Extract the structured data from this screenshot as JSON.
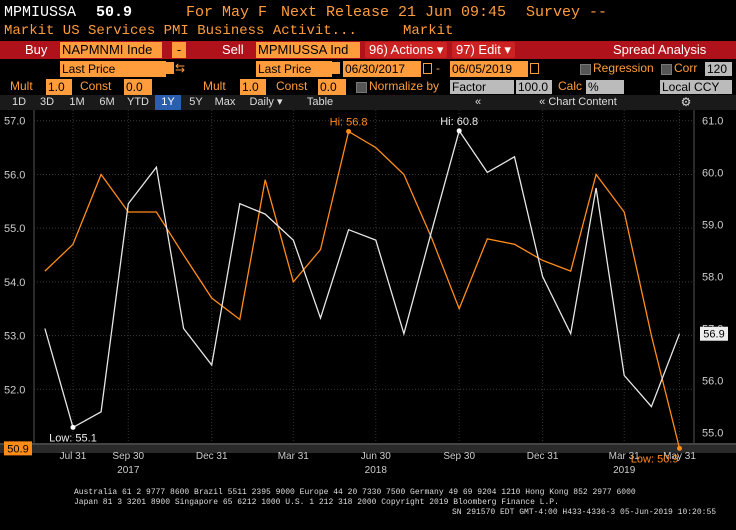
{
  "header": {
    "ticker": "MPMIUSSA",
    "value": "50.9",
    "for_label": "For May F",
    "next_release": "Next Release 21 Jun 09:45",
    "survey": "Survey --",
    "description": "Markit US Services PMI Business Activit...",
    "source": "Markit"
  },
  "toolbar": {
    "buy_label": "Buy",
    "buy_security": "NAPMNMI Inde",
    "minus": "-",
    "sell_label": "Sell",
    "sell_security": "MPMIUSSA Ind",
    "actions_label": "96) Actions ▾",
    "edit_label": "97) Edit ▾",
    "spread_label": "Spread Analysis"
  },
  "row3": {
    "field1": "Last Price",
    "swap": "⇆",
    "field2": "Last Price",
    "start_date": "06/30/2017",
    "dash": "-",
    "end_date": "06/05/2019",
    "regression": "Regression",
    "corr": "Corr",
    "corr_value": "120"
  },
  "row4": {
    "mult1_label": "Mult",
    "mult1": "1.0",
    "const1_label": "Const",
    "const1": "0.0",
    "mult2_label": "Mult",
    "mult2": "1.0",
    "const2_label": "Const",
    "const2": "0.0",
    "normalize_label": "Normalize by",
    "normalize_value": "Factor",
    "factor": "100.0",
    "calc_label": "Calc",
    "calc_value": "%",
    "ccy": "Local CCY"
  },
  "tabs": {
    "items": [
      "1D",
      "3D",
      "1M",
      "6M",
      "YTD",
      "1Y",
      "5Y",
      "Max",
      "Daily ▾",
      "Table"
    ],
    "collapse": "«",
    "chart_content": "« Chart Content",
    "gear": "⚙"
  },
  "chart_data": {
    "type": "line",
    "x": [
      "2017-06-30",
      "2017-07-31",
      "2017-08-31",
      "2017-09-30",
      "2017-10-31",
      "2017-11-30",
      "2017-12-31",
      "2018-01-31",
      "2018-02-28",
      "2018-03-31",
      "2018-04-30",
      "2018-05-31",
      "2018-06-30",
      "2018-07-31",
      "2018-08-31",
      "2018-09-30",
      "2018-10-31",
      "2018-11-30",
      "2018-12-31",
      "2019-01-31",
      "2019-02-28",
      "2019-03-31",
      "2019-04-30",
      "2019-05-31"
    ],
    "series": [
      {
        "name": "MPMIUSSA",
        "color": "#ff8c1a",
        "axis": "left",
        "values": [
          54.2,
          54.7,
          56.0,
          55.3,
          55.3,
          54.5,
          53.7,
          53.3,
          55.9,
          54.0,
          54.6,
          56.8,
          56.5,
          56.0,
          54.8,
          53.5,
          54.8,
          54.7,
          54.4,
          54.2,
          56.0,
          55.3,
          53.0,
          50.9
        ]
      },
      {
        "name": "NAPMNMI",
        "color": "#e6e6e6",
        "axis": "right",
        "values": [
          57.0,
          55.1,
          55.4,
          59.4,
          60.1,
          57.0,
          56.3,
          59.4,
          59.2,
          58.7,
          57.2,
          58.9,
          58.7,
          56.9,
          58.9,
          60.8,
          60.0,
          60.3,
          58.0,
          56.9,
          59.7,
          56.1,
          55.5,
          56.9
        ]
      }
    ],
    "yleft": {
      "lim": [
        51.0,
        57.2
      ],
      "ticks": [
        "52.0",
        "53.0",
        "54.0",
        "55.0",
        "56.0",
        "57.0"
      ]
    },
    "yright": {
      "lim": [
        54.8,
        61.2
      ],
      "ticks": [
        "55.0",
        "56.0",
        "57.0",
        "58.0",
        "59.0",
        "60.0",
        "61.0"
      ]
    },
    "x_tick_labels": [
      "Jul 31",
      "Sep 30",
      "Dec 31",
      "Mar 31",
      "Jun 30",
      "Sep 30",
      "Dec 31",
      "Mar 31",
      "May 31"
    ],
    "x_tick_dates": [
      "2017-07-31",
      "2017-09-30",
      "2017-12-31",
      "2018-03-31",
      "2018-06-30",
      "2018-09-30",
      "2018-12-31",
      "2019-03-31",
      "2019-05-31"
    ],
    "year_labels": [
      "2017",
      "2018",
      "2019"
    ],
    "year_centers": [
      "2017-09-30",
      "2018-06-30",
      "2019-03-31"
    ],
    "annotations": {
      "orange_hi": "Hi: 56.8",
      "orange_low": "Low: 50.9",
      "white_hi": "Hi: 60.8",
      "white_low": "Low: 55.1",
      "left_last": "50.9",
      "right_last": "56.9"
    },
    "grid": true
  },
  "footer": {
    "line1": "Australia 61 2 9777 8600 Brazil 5511 2395 9000 Europe 44 20 7330 7500 Germany 49 69 9204 1210 Hong Kong 852 2977 6000",
    "line2": "Japan 81 3 3201 8900         Singapore 65 6212 1000         U.S. 1 212 318 2000         Copyright 2019 Bloomberg Finance L.P.",
    "line3": "SN 291570 EDT  GMT-4:00 H433-4336-3 05-Jun-2019 10:20:55"
  }
}
